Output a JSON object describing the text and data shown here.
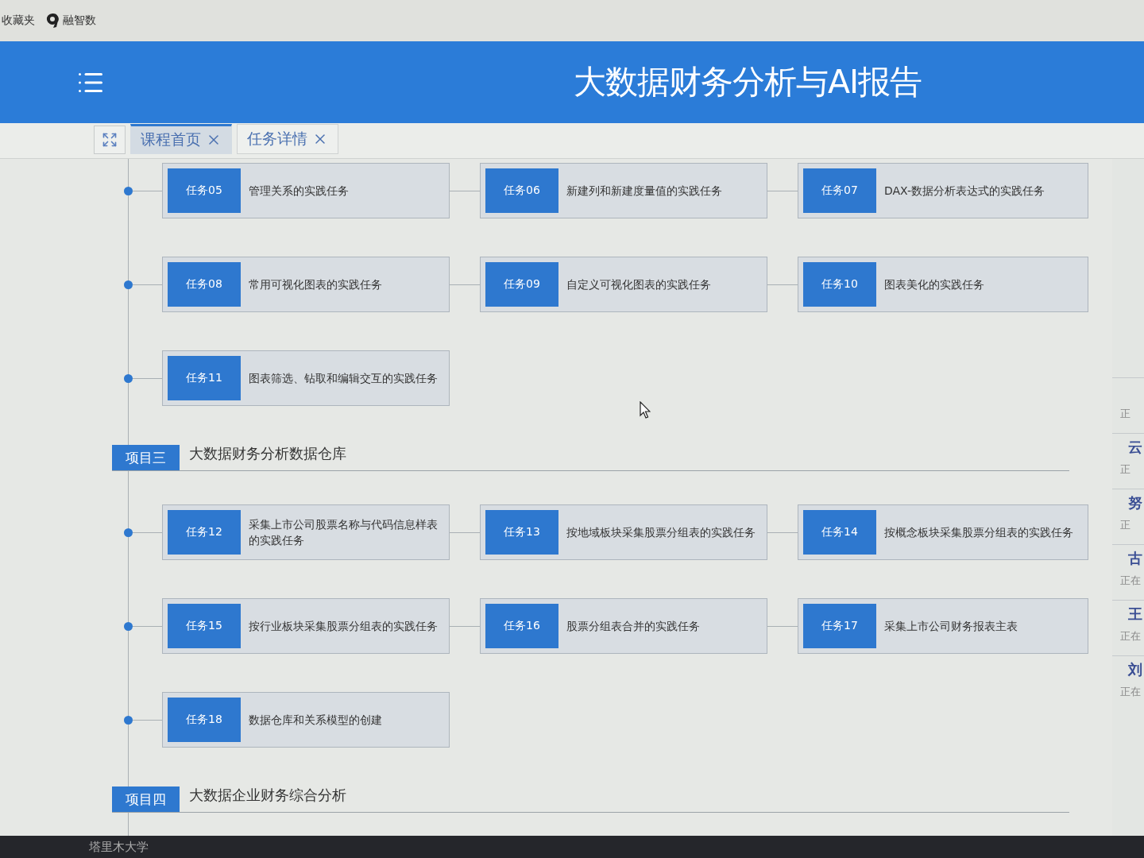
{
  "browser": {
    "bookmarks": [
      {
        "label": "收藏夹",
        "kind": "folder"
      },
      {
        "label": "融智数",
        "kind": "site"
      }
    ]
  },
  "header": {
    "title": "大数据财务分析与AI报告"
  },
  "tabs": [
    {
      "label": "课程首页",
      "selected": true
    },
    {
      "label": "任务详情",
      "selected": false
    }
  ],
  "sections": [
    {
      "tasks": [
        {
          "code": "任务05",
          "name": "管理关系的实践任务"
        },
        {
          "code": "任务06",
          "name": "新建列和新建度量值的实践任务"
        },
        {
          "code": "任务07",
          "name": "DAX-数据分析表达式的实践任务"
        },
        {
          "code": "任务08",
          "name": "常用可视化图表的实践任务"
        },
        {
          "code": "任务09",
          "name": "自定义可视化图表的实践任务"
        },
        {
          "code": "任务10",
          "name": "图表美化的实践任务"
        },
        {
          "code": "任务11",
          "name": "图表筛选、钻取和编辑交互的实践任务"
        }
      ]
    },
    {
      "tag": "项目三",
      "title": "大数据财务分析数据仓库",
      "tasks": [
        {
          "code": "任务12",
          "name": "采集上市公司股票名称与代码信息样表的实践任务"
        },
        {
          "code": "任务13",
          "name": "按地域板块采集股票分组表的实践任务"
        },
        {
          "code": "任务14",
          "name": "按概念板块采集股票分组表的实践任务"
        },
        {
          "code": "任务15",
          "name": "按行业板块采集股票分组表的实践任务"
        },
        {
          "code": "任务16",
          "name": "股票分组表合并的实践任务"
        },
        {
          "code": "任务17",
          "name": "采集上市公司财务报表主表"
        },
        {
          "code": "任务18",
          "name": "数据仓库和关系模型的创建"
        }
      ]
    },
    {
      "tag": "项目四",
      "title": "大数据企业财务综合分析"
    }
  ],
  "side_list": [
    {
      "status": "正"
    },
    {
      "name": "云",
      "status": "正"
    },
    {
      "name": "努",
      "status": "正"
    },
    {
      "name": "古",
      "status": "正在"
    },
    {
      "name": "王",
      "status": "正在"
    },
    {
      "name": "刘",
      "status": "正在"
    }
  ],
  "taskbar": {
    "label": "塔里木大学"
  }
}
